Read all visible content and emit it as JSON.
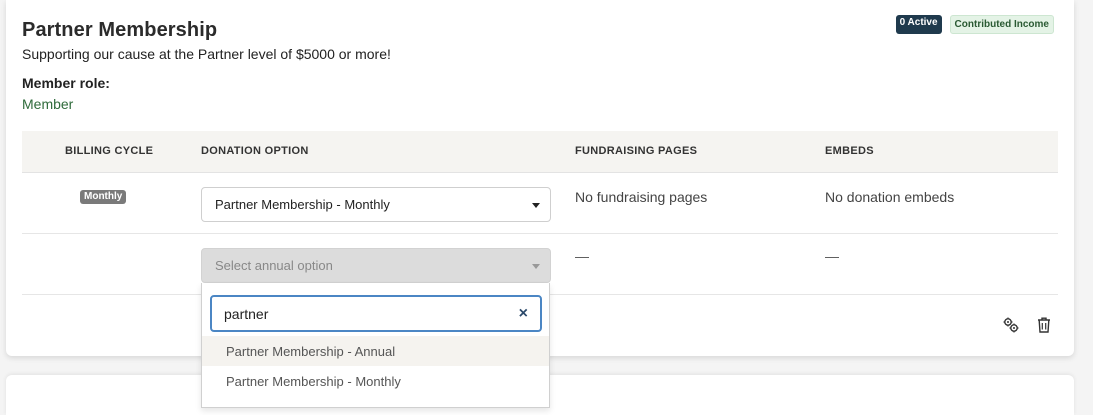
{
  "membership": {
    "title": "Partner Membership",
    "subtitle": "Supporting our cause at the Partner level of $5000 or more!",
    "role_label": "Member role:",
    "role_value": "Member",
    "badges": {
      "active": "0 Active",
      "income": "Contributed Income"
    }
  },
  "table": {
    "headers": [
      "BILLING CYCLE",
      "DONATION OPTION",
      "FUNDRAISING PAGES",
      "EMBEDS"
    ],
    "rows": [
      {
        "cycle": "Monthly",
        "donation_option": "Partner Membership - Monthly",
        "fundraising": "No fundraising pages",
        "embeds": "No donation embeds"
      },
      {
        "cycle": "",
        "donation_option_placeholder": "Select annual option",
        "fundraising": "—",
        "embeds": "—"
      }
    ]
  },
  "dropdown": {
    "search_value": "partner",
    "clear_icon": "×",
    "options": [
      "Partner Membership - Annual",
      "Partner Membership - Monthly"
    ]
  },
  "actions": {
    "settings_icon": "gears-icon",
    "delete_icon": "trash-icon"
  },
  "colors": {
    "accent": "#4b86c4",
    "active_badge": "#1f3a4d",
    "income_badge": "#e4f3e6",
    "role": "#2f6b3b"
  }
}
